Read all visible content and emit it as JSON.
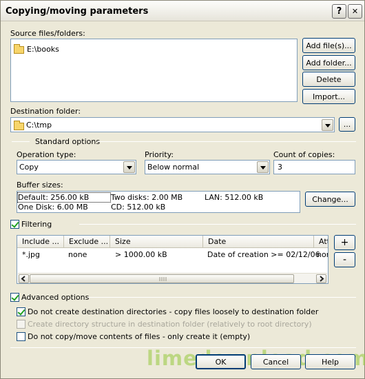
{
  "window": {
    "title": "Copying/moving parameters",
    "help_btn": "?",
    "close_btn": "✕"
  },
  "source": {
    "label": "Source files/folders:",
    "items": [
      "E:\\books"
    ],
    "buttons": {
      "add_files": "Add file(s)...",
      "add_folder": "Add folder...",
      "delete": "Delete",
      "import": "Import..."
    }
  },
  "destination": {
    "label": "Destination folder:",
    "value": "C:\\tmp",
    "browse": "..."
  },
  "standard_options": {
    "title": "Standard options",
    "operation_type": {
      "label": "Operation type:",
      "value": "Copy"
    },
    "priority": {
      "label": "Priority:",
      "value": "Below normal"
    },
    "copies": {
      "label": "Count of copies:",
      "value": "3"
    },
    "buffer": {
      "label": "Buffer sizes:",
      "default": "Default: 256.00 kB",
      "two_disks": "Two disks: 2.00 MB",
      "lan": "LAN: 512.00 kB",
      "one_disk": "One Disk: 6.00 MB",
      "cd": "CD: 512.00 kB",
      "change": "Change..."
    }
  },
  "filtering": {
    "label": "Filtering",
    "checked": true,
    "columns": [
      "Include ...",
      "Exclude ...",
      "Size",
      "Date",
      "Att"
    ],
    "rows": [
      [
        "*.jpg",
        "none",
        "> 1000.00 kB",
        "Date of creation >= 02/12/06",
        "nor"
      ]
    ],
    "add": "+",
    "remove": "-"
  },
  "advanced": {
    "label": "Advanced options",
    "checked": true,
    "options": [
      {
        "label": "Do not create destination directories - copy files loosely to destination folder",
        "checked": true,
        "enabled": true
      },
      {
        "label": "Create directory structure in destination folder (relatively to root directory)",
        "checked": false,
        "enabled": false
      },
      {
        "label": "Do not copy/move contents of files - only create it (empty)",
        "checked": false,
        "enabled": true
      }
    ]
  },
  "footer": {
    "ok": "OK",
    "cancel": "Cancel",
    "help": "Help"
  },
  "watermark": "limedownload.com",
  "colors": {
    "dialog_bg": "#ece9d8",
    "border_blue": "#7f9db9",
    "check_green": "#21a121"
  }
}
